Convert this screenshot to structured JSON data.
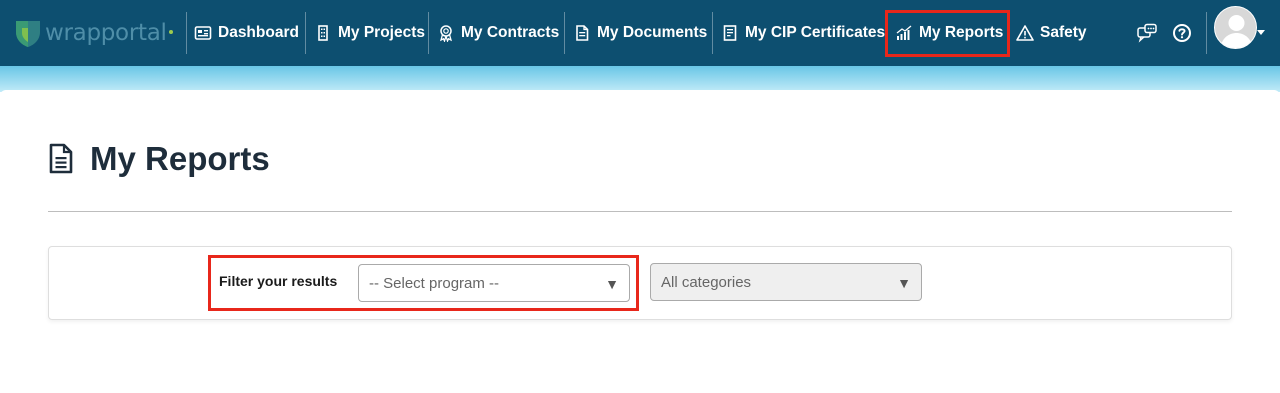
{
  "app": {
    "logo_text": "wrapportal",
    "colors": {
      "header": "#0d4f70",
      "highlight": "#e8271b",
      "title": "#1e2d3b"
    }
  },
  "nav": {
    "items": [
      {
        "label": "Dashboard",
        "icon": "dashboard-icon"
      },
      {
        "label": "My Projects",
        "icon": "building-icon"
      },
      {
        "label": "My Contracts",
        "icon": "award-icon"
      },
      {
        "label": "My Documents",
        "icon": "documents-icon"
      },
      {
        "label": "My CIP Certificates",
        "icon": "certificate-icon"
      },
      {
        "label": "My Reports",
        "icon": "chart-icon",
        "active": true
      },
      {
        "label": "Safety",
        "icon": "warning-icon"
      }
    ],
    "right_icons": [
      "chat-icon",
      "help-icon",
      "avatar"
    ]
  },
  "page": {
    "title": "My Reports",
    "title_icon": "document-icon"
  },
  "filter": {
    "label": "Filter your results",
    "program_select": {
      "value": "-- Select program  --"
    },
    "category_select": {
      "value": "All categories"
    }
  }
}
